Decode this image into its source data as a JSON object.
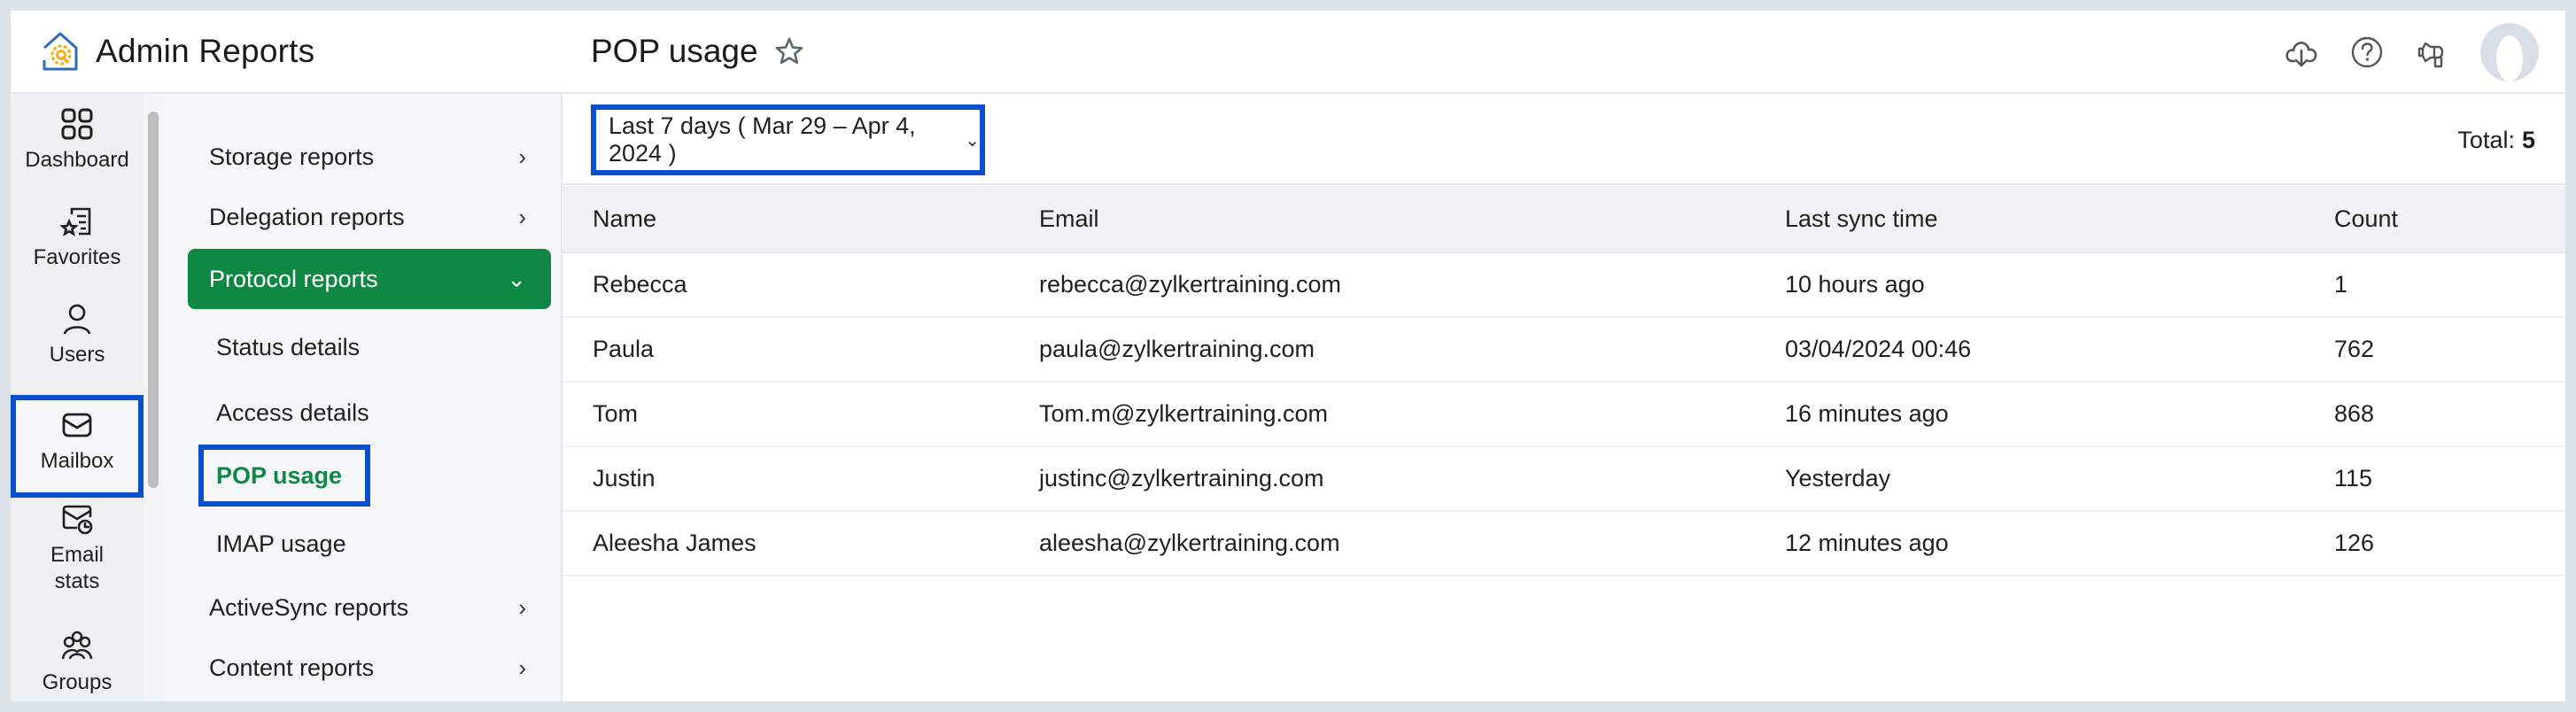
{
  "app": {
    "title": "Admin Reports",
    "logo_icon": "admin-reports-logo"
  },
  "rail": {
    "items": [
      {
        "label": "Dashboard",
        "icon": "dashboard-grid-icon",
        "selected": false
      },
      {
        "label": "Favorites",
        "icon": "favorites-list-star-icon",
        "selected": false
      },
      {
        "label": "Users",
        "icon": "user-icon",
        "selected": false
      },
      {
        "label": "Mailbox",
        "icon": "mail-envelope-icon",
        "selected": true
      },
      {
        "label": "Email stats",
        "icon": "email-stats-icon",
        "selected": false
      },
      {
        "label": "Groups",
        "icon": "groups-icon",
        "selected": false
      }
    ]
  },
  "submenu": {
    "items": [
      {
        "label": "Storage reports",
        "chevron": "›"
      },
      {
        "label": "Delegation reports",
        "chevron": "›"
      },
      {
        "label": "Protocol reports",
        "chevron": "⌄",
        "active": true
      },
      {
        "label": "ActiveSync reports",
        "chevron": "›"
      },
      {
        "label": "Content reports",
        "chevron": "›"
      }
    ],
    "protocol_children": [
      {
        "label": "Status details"
      },
      {
        "label": "Access details"
      },
      {
        "label": "POP usage",
        "current": true
      },
      {
        "label": "IMAP usage"
      }
    ]
  },
  "header": {
    "page_title": "POP usage",
    "favorite_icon": "star-outline-icon",
    "icons": [
      "cloud-download-icon",
      "help-icon",
      "announcement-megaphone-icon",
      "avatar"
    ]
  },
  "filter": {
    "date_range": "Last 7 days ( Mar 29 – Apr 4, 2024 )",
    "total_label": "Total:",
    "total_value": "5"
  },
  "table": {
    "columns": [
      "Name",
      "Email",
      "Last sync time",
      "Count"
    ],
    "rows": [
      [
        "Rebecca",
        "rebecca@zylkertraining.com",
        "10 hours ago",
        "1"
      ],
      [
        "Paula",
        "paula@zylkertraining.com",
        "03/04/2024 00:46",
        "762"
      ],
      [
        "Tom",
        "Tom.m@zylkertraining.com",
        "16 minutes ago",
        "868"
      ],
      [
        "Justin",
        "justinc@zylkertraining.com",
        "Yesterday",
        "115"
      ],
      [
        "Aleesha James",
        "aleesha@zylkertraining.com",
        "12 minutes ago",
        "126"
      ]
    ]
  },
  "colors": {
    "accent_green": "#0f8844",
    "highlight_blue": "#0b4fcf",
    "frame": "#dbe2e8"
  }
}
